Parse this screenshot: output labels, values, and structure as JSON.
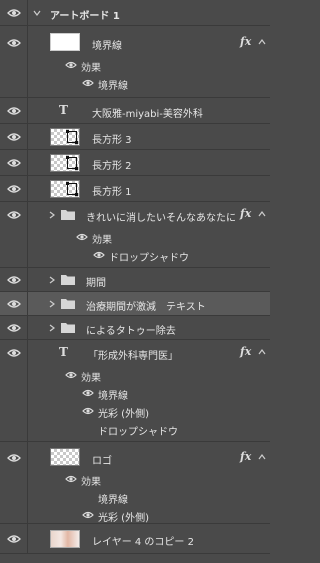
{
  "artboard": {
    "title": "アートボード 1"
  },
  "layers": [
    {
      "name": "境界線",
      "fx": "fx",
      "effects_label": "効果",
      "effects": [
        "境界線"
      ]
    },
    {
      "name": "大阪雅-miyabi-美容外科"
    },
    {
      "name": "長方形 3"
    },
    {
      "name": "長方形 2"
    },
    {
      "name": "長方形 1"
    },
    {
      "name": "きれいに消したいそんなあなたに",
      "fx": "fx",
      "effects_label": "効果",
      "effects": [
        "ドロップシャドウ"
      ]
    },
    {
      "name": "期間"
    },
    {
      "name": "治療期間が激減　テキスト"
    },
    {
      "name": "によるタトゥー除去"
    },
    {
      "name": "「形成外科専門医」",
      "fx": "fx",
      "effects_label": "効果",
      "effects": [
        "境界線",
        "光彩 (外側)",
        "ドロップシャドウ"
      ]
    },
    {
      "name": "ロゴ",
      "fx": "fx",
      "effects_label": "効果",
      "effects": [
        "境界線",
        "光彩 (外側)"
      ]
    },
    {
      "name": "レイヤー 4 のコピー 2"
    }
  ],
  "colors": {
    "panel_bg": "#4a4a4a",
    "selected_row": "#5a5a5a",
    "divider": "#3a3a3a",
    "text": "#e6e6e6"
  },
  "icons": {
    "visibility": "eye-icon",
    "group": "folder-icon",
    "text_layer": "T-icon",
    "expand": "chevron-right-icon",
    "collapse": "chevron-down-icon",
    "effects": "fx-icon",
    "effects_toggle": "caret-up-icon"
  }
}
